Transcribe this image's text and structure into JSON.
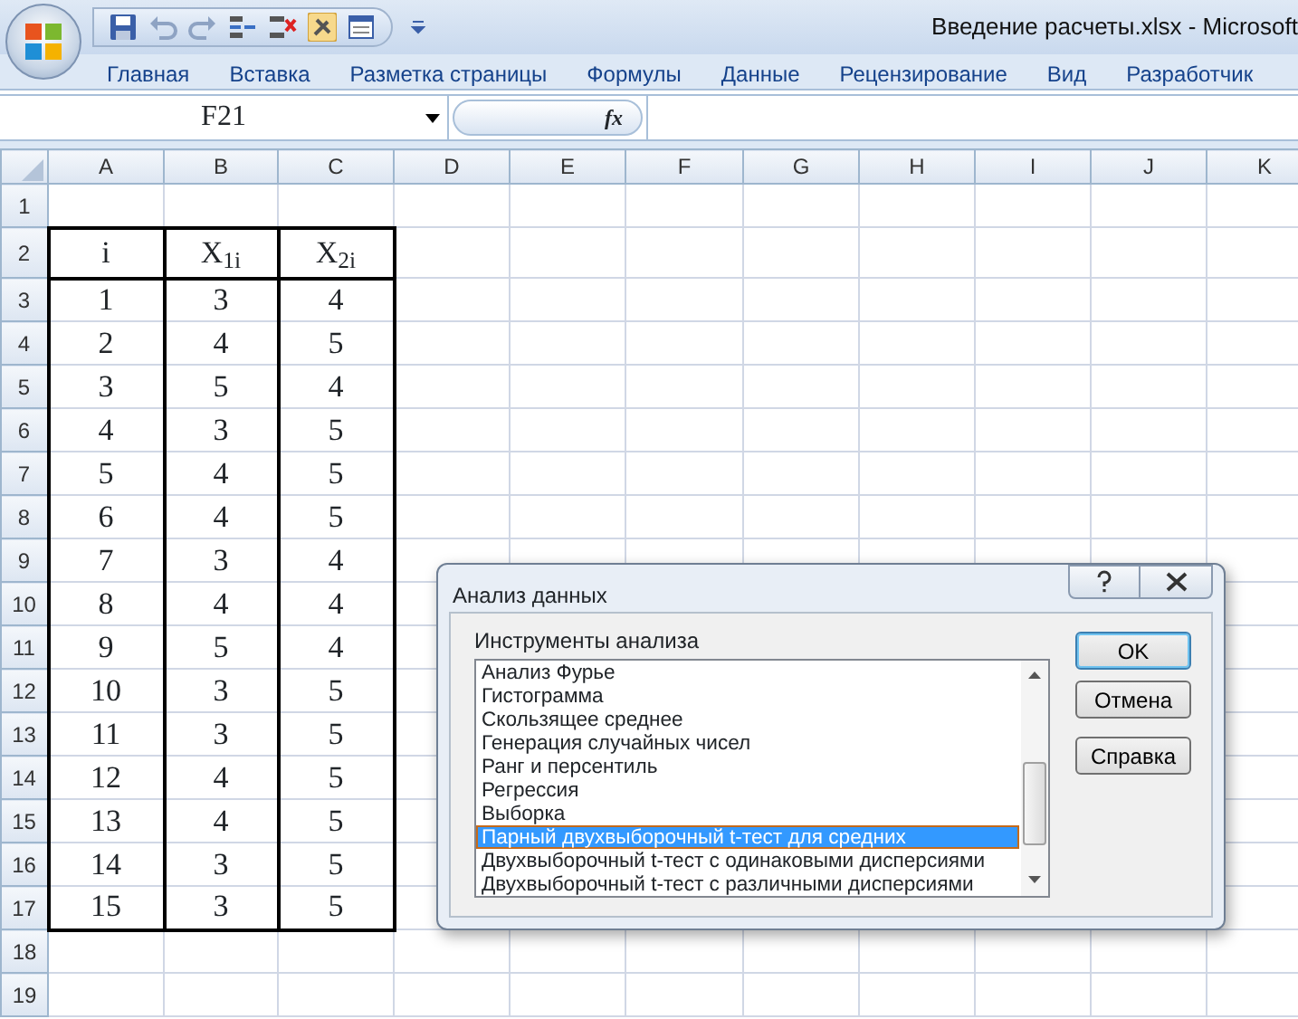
{
  "window": {
    "title": "Введение расчеты.xlsx - Microsoft"
  },
  "ribbon_tabs": [
    {
      "label": "Главная"
    },
    {
      "label": "Вставка"
    },
    {
      "label": "Разметка страницы"
    },
    {
      "label": "Формулы"
    },
    {
      "label": "Данные"
    },
    {
      "label": "Рецензирование"
    },
    {
      "label": "Вид"
    },
    {
      "label": "Разработчик"
    }
  ],
  "name_box": "F21",
  "formula_bar": {
    "function_label": "fx"
  },
  "sheet": {
    "columns": [
      "A",
      "B",
      "C",
      "D",
      "E",
      "F",
      "G",
      "H",
      "I",
      "J",
      "K"
    ],
    "rows": [
      {
        "number": "1"
      },
      {
        "number": "2",
        "cells": [
          "i",
          "X$_{1i}$",
          "X$_{2i}$"
        ]
      },
      {
        "number": "3",
        "cells": [
          "1",
          "3",
          "4"
        ]
      },
      {
        "number": "4",
        "cells": [
          "2",
          "4",
          "5"
        ]
      },
      {
        "number": "5",
        "cells": [
          "3",
          "5",
          "4"
        ]
      },
      {
        "number": "6",
        "cells": [
          "4",
          "3",
          "5"
        ]
      },
      {
        "number": "7",
        "cells": [
          "5",
          "4",
          "5"
        ]
      },
      {
        "number": "8",
        "cells": [
          "6",
          "4",
          "5"
        ]
      },
      {
        "number": "9",
        "cells": [
          "7",
          "3",
          "4"
        ]
      },
      {
        "number": "10",
        "cells": [
          "8",
          "4",
          "4"
        ]
      },
      {
        "number": "11",
        "cells": [
          "9",
          "5",
          "4"
        ]
      },
      {
        "number": "12",
        "cells": [
          "10",
          "3",
          "5"
        ]
      },
      {
        "number": "13",
        "cells": [
          "11",
          "3",
          "5"
        ]
      },
      {
        "number": "14",
        "cells": [
          "12",
          "4",
          "5"
        ]
      },
      {
        "number": "15",
        "cells": [
          "13",
          "4",
          "5"
        ]
      },
      {
        "number": "16",
        "cells": [
          "14",
          "3",
          "5"
        ]
      },
      {
        "number": "17",
        "cells": [
          "15",
          "3",
          "5"
        ]
      },
      {
        "number": "18"
      },
      {
        "number": "19"
      }
    ]
  },
  "dialog": {
    "title": "Анализ данных",
    "list_label": "Инструменты анализа",
    "items": [
      {
        "label": "Анализ Фурье",
        "selected": false
      },
      {
        "label": "Гистограмма",
        "selected": false
      },
      {
        "label": "Скользящее среднее",
        "selected": false
      },
      {
        "label": "Генерация случайных чисел",
        "selected": false
      },
      {
        "label": "Ранг и персентиль",
        "selected": false
      },
      {
        "label": "Регрессия",
        "selected": false
      },
      {
        "label": "Выборка",
        "selected": false
      },
      {
        "label": "Парный двухвыборочный t-тест для средних",
        "selected": true
      },
      {
        "label": "Двухвыборочный t-тест с одинаковыми дисперсиями",
        "selected": false
      },
      {
        "label": "Двухвыборочный t-тест с различными дисперсиями",
        "selected": false
      }
    ],
    "buttons": [
      {
        "label": "OK",
        "default": true
      },
      {
        "label": "Отмена",
        "default": false
      },
      {
        "label": "Справка",
        "default": false
      }
    ]
  }
}
